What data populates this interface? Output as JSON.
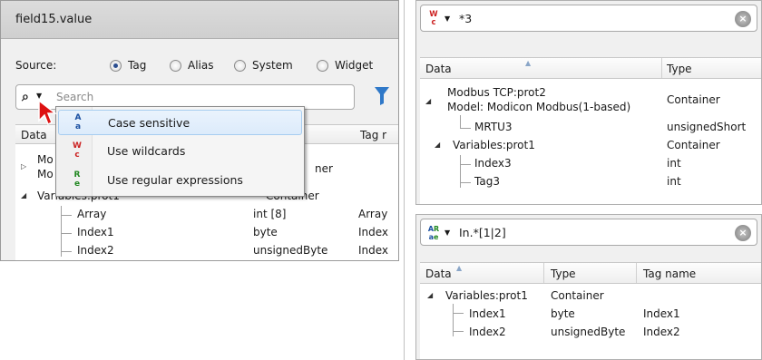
{
  "left": {
    "window_title": "field15.value",
    "source_label": "Source:",
    "radios": [
      {
        "label": "Tag",
        "selected": true
      },
      {
        "label": "Alias",
        "selected": false
      },
      {
        "label": "System",
        "selected": false
      },
      {
        "label": "Widget",
        "selected": false
      }
    ],
    "search_placeholder": "Search",
    "columns": [
      "Data",
      "Tag r"
    ],
    "rows": [
      {
        "data": "Mo",
        "type": "",
        "tag": ""
      },
      {
        "data": "Mo",
        "type": "ner",
        "tag": ""
      },
      {
        "data": "Variables:prot1",
        "type": "Container",
        "tag": ""
      },
      {
        "data": "Array",
        "type": "int [8]",
        "tag": "Array"
      },
      {
        "data": "Index1",
        "type": "byte",
        "tag": "Index"
      },
      {
        "data": "Index2",
        "type": "unsignedByte",
        "tag": "Index"
      }
    ],
    "dropdown": [
      {
        "icon": "Aa",
        "label": "Case sensitive"
      },
      {
        "icon": "Wc",
        "label": "Use wildcards"
      },
      {
        "icon": "Re",
        "label": "Use regular expressions"
      }
    ]
  },
  "top_right": {
    "search_value": "*3",
    "columns": [
      "Data",
      "Type"
    ],
    "rows": [
      {
        "data": "Modbus TCP:prot2",
        "data2": "Model: Modicon Modbus(1-based)",
        "type": "Container"
      },
      {
        "data": "MRTU3",
        "type": "unsignedShort"
      },
      {
        "data": "Variables:prot1",
        "type": "Container"
      },
      {
        "data": "Index3",
        "type": "int"
      },
      {
        "data": "Tag3",
        "type": "int"
      }
    ]
  },
  "bottom_right": {
    "search_value": "In.*[1|2]",
    "columns": [
      "Data",
      "Type",
      "Tag name"
    ],
    "rows": [
      {
        "data": "Variables:prot1",
        "type": "Container",
        "tag": ""
      },
      {
        "data": "Index1",
        "type": "byte",
        "tag": "Index1"
      },
      {
        "data": "Index2",
        "type": "unsignedByte",
        "tag": "Index2"
      }
    ]
  },
  "colors": {
    "wildcard_icon": "#cc2222",
    "regex_icon": "#228822",
    "case_icon": "#1a4fa0",
    "filter_icon": "#2f78c8",
    "cursor": "#dd1111"
  }
}
